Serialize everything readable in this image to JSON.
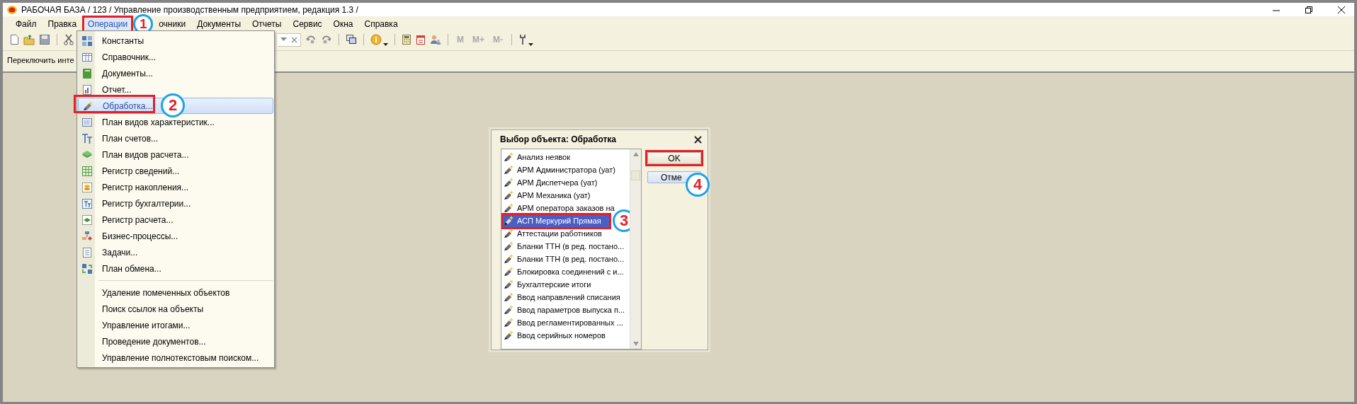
{
  "window": {
    "title": "РАБОЧАЯ БАЗА / 123 /  Управление производственным предприятием, редакция 1.3 /"
  },
  "menu_bar": [
    {
      "label": "Файл",
      "selected": false,
      "outlined": false
    },
    {
      "label": "Правка",
      "selected": false,
      "outlined": false
    },
    {
      "label": "Операции",
      "selected": true,
      "outlined": true,
      "callout": "1"
    },
    {
      "label": "очники",
      "selected": false,
      "outlined": false
    },
    {
      "label": "Документы",
      "selected": false,
      "outlined": false
    },
    {
      "label": "Отчеты",
      "selected": false,
      "outlined": false
    },
    {
      "label": "Сервис",
      "selected": false,
      "outlined": false
    },
    {
      "label": "Окна",
      "selected": false,
      "outlined": false
    },
    {
      "label": "Справка",
      "selected": false,
      "outlined": false
    }
  ],
  "toolbar": {
    "memory_buttons": [
      {
        "label": "M",
        "disabled": true
      },
      {
        "label": "M+",
        "disabled": true
      },
      {
        "label": "M-",
        "disabled": true
      }
    ]
  },
  "toolbar_2": {
    "label": "Переключить инте"
  },
  "dropdown_menu": {
    "groups": [
      [
        {
          "label": "Константы",
          "selected": false,
          "outlined": false
        },
        {
          "label": "Справочник...",
          "selected": false,
          "outlined": false
        },
        {
          "label": "Документы...",
          "selected": false,
          "outlined": false
        },
        {
          "label": "Отчет...",
          "selected": false,
          "outlined": false
        },
        {
          "label": "Обработка...",
          "selected": true,
          "outlined": true,
          "callout": "2"
        },
        {
          "label": "План видов характеристик...",
          "selected": false,
          "outlined": false
        },
        {
          "label": "План счетов...",
          "selected": false,
          "outlined": false
        },
        {
          "label": "План видов расчета...",
          "selected": false,
          "outlined": false
        },
        {
          "label": "Регистр сведений...",
          "selected": false,
          "outlined": false
        },
        {
          "label": "Регистр накопления...",
          "selected": false,
          "outlined": false
        },
        {
          "label": "Регистр бухгалтерии...",
          "selected": false,
          "outlined": false
        },
        {
          "label": "Регистр расчета...",
          "selected": false,
          "outlined": false
        },
        {
          "label": "Бизнес-процессы...",
          "selected": false,
          "outlined": false
        },
        {
          "label": "Задачи...",
          "selected": false,
          "outlined": false
        },
        {
          "label": "План обмена...",
          "selected": false,
          "outlined": false
        }
      ],
      [
        {
          "label": "Удаление помеченных объектов",
          "selected": false,
          "outlined": false
        },
        {
          "label": "Поиск ссылок на объекты",
          "selected": false,
          "outlined": false
        },
        {
          "label": "Управление итогами...",
          "selected": false,
          "outlined": false
        },
        {
          "label": "Проведение документов...",
          "selected": false,
          "outlined": false
        },
        {
          "label": "Управление полнотекстовым поиском...",
          "selected": false,
          "outlined": false
        }
      ]
    ]
  },
  "dialog": {
    "title": "Выбор объекта: Обработка",
    "items": [
      {
        "label": "Анализ неявок",
        "selected": false,
        "outlined": false
      },
      {
        "label": "АРМ Администратора (уат)",
        "selected": false,
        "outlined": false
      },
      {
        "label": "АРМ Диспетчера (уат)",
        "selected": false,
        "outlined": false
      },
      {
        "label": "АРМ Механика (уат)",
        "selected": false,
        "outlined": false
      },
      {
        "label": "АРМ оператора заказов на",
        "selected": false,
        "outlined": false
      },
      {
        "label": "АСП Меркурий Прямая",
        "selected": true,
        "outlined": true,
        "callout": "3"
      },
      {
        "label": "Аттестации работников",
        "selected": false,
        "outlined": false
      },
      {
        "label": "Бланки ТТН (в ред. постано...",
        "selected": false,
        "outlined": false
      },
      {
        "label": "Бланки ТТН (в ред. постано...",
        "selected": false,
        "outlined": false
      },
      {
        "label": "Блокировка соединений с и...",
        "selected": false,
        "outlined": false
      },
      {
        "label": "Бухгалтерские итоги",
        "selected": false,
        "outlined": false
      },
      {
        "label": "Ввод направлений списания",
        "selected": false,
        "outlined": false
      },
      {
        "label": "Ввод параметров выпуска п...",
        "selected": false,
        "outlined": false
      },
      {
        "label": "Ввод регламентированных ...",
        "selected": false,
        "outlined": false
      },
      {
        "label": "Ввод серийных номеров",
        "selected": false,
        "outlined": false
      }
    ],
    "buttons": [
      {
        "label": "OK",
        "outlined": true
      },
      {
        "label": "Отме",
        "outlined": false,
        "callout": "4"
      }
    ]
  }
}
